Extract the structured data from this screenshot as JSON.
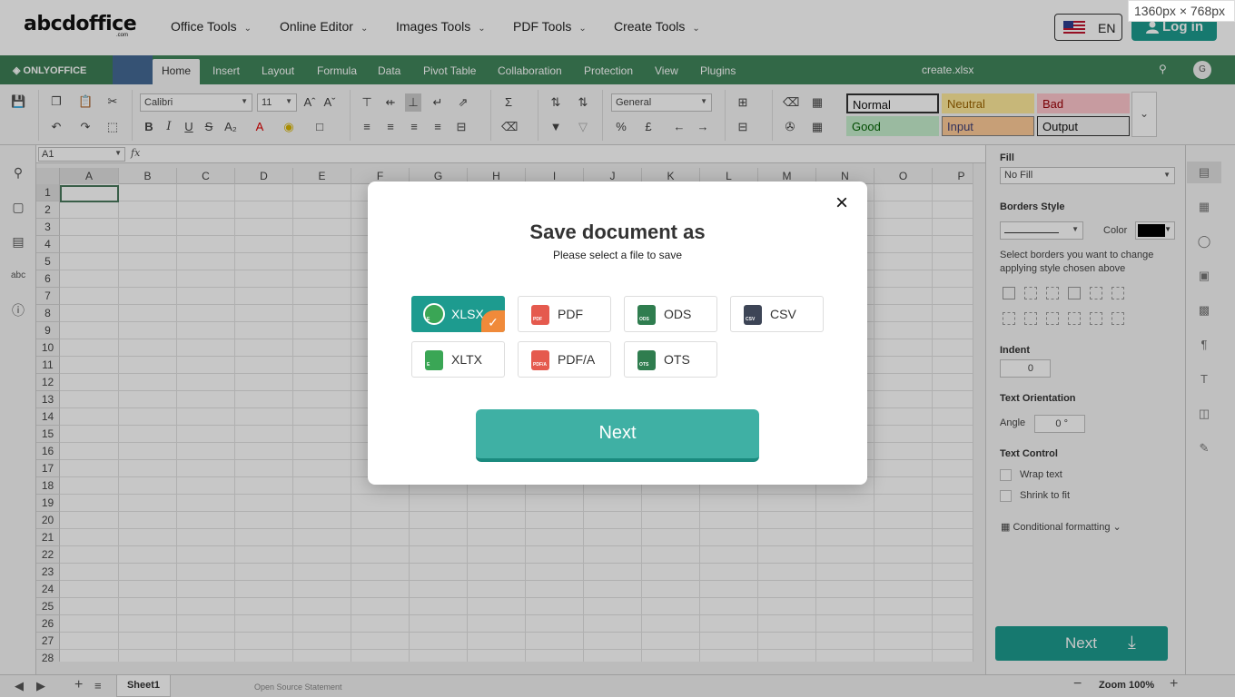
{
  "site": {
    "logo": "abcdoffice",
    "logo_sub": ".com",
    "nav": [
      "Office Tools",
      "Online Editor",
      "Images Tools",
      "PDF Tools",
      "Create Tools"
    ],
    "lang": "EN",
    "login": "Log in",
    "size_badge": "1360px × 768px"
  },
  "editor": {
    "brand": "ONLYOFFICE",
    "tabs": [
      "Home",
      "Insert",
      "Layout",
      "Formula",
      "Data",
      "Pivot Table",
      "Collaboration",
      "Protection",
      "View",
      "Plugins"
    ],
    "active_tab": "Home",
    "doc_title": "create.xlsx",
    "avatar_initial": "G"
  },
  "toolbar": {
    "font_name": "Calibri",
    "font_size": "11",
    "number_format": "General",
    "styles": [
      {
        "label": "Normal",
        "bg": "#ffffff",
        "fg": "#111111",
        "border": "#333333"
      },
      {
        "label": "Neutral",
        "bg": "#ffeb9c",
        "fg": "#9c6500",
        "border": "#ffeb9c"
      },
      {
        "label": "Bad",
        "bg": "#ffc7ce",
        "fg": "#9c0006",
        "border": "#ffc7ce"
      },
      {
        "label": "Good",
        "bg": "#c6efce",
        "fg": "#006100",
        "border": "#c6efce"
      },
      {
        "label": "Input",
        "bg": "#ffcc99",
        "fg": "#3f3f76",
        "border": "#7f7f7f"
      },
      {
        "label": "Output",
        "bg": "#f2f2f2",
        "fg": "#111111",
        "border": "#333333"
      }
    ]
  },
  "formula_bar": {
    "cell_ref": "A1",
    "fx": "fx"
  },
  "grid": {
    "columns": [
      "A",
      "B",
      "C",
      "D",
      "E",
      "F",
      "G",
      "H",
      "I",
      "J",
      "K",
      "L",
      "M",
      "N",
      "O",
      "P"
    ],
    "rows": [
      "1",
      "2",
      "3",
      "4",
      "5",
      "6",
      "7",
      "8",
      "9",
      "10",
      "11",
      "12",
      "13",
      "14",
      "15",
      "16",
      "17",
      "18",
      "19",
      "20",
      "21",
      "22",
      "23",
      "24",
      "25",
      "26",
      "27",
      "28"
    ]
  },
  "bottom": {
    "sheet": "Sheet1",
    "open_source": "Open Source Statement",
    "zoom": "Zoom 100%"
  },
  "right_panel": {
    "fill_label": "Fill",
    "fill_value": "No Fill",
    "borders_label": "Borders Style",
    "color_label": "Color",
    "borders_hint": "Select borders you want to change applying style chosen above",
    "indent_label": "Indent",
    "indent_value": "0",
    "orientation_label": "Text Orientation",
    "angle_label": "Angle",
    "angle_value": "0 °",
    "text_control_label": "Text Control",
    "wrap_text": "Wrap text",
    "shrink_to_fit": "Shrink to fit",
    "conditional_formatting": "Conditional formatting",
    "next": "Next"
  },
  "dialog": {
    "title": "Save document as",
    "subtitle": "Please select a file to save",
    "formats": [
      {
        "label": "XLSX",
        "icon": "xlsx-file-icon",
        "color": "#3aa655",
        "tag": "E",
        "selected": true
      },
      {
        "label": "PDF",
        "icon": "pdf-file-icon",
        "color": "#e55a4e",
        "tag": "PDF",
        "selected": false
      },
      {
        "label": "ODS",
        "icon": "ods-file-icon",
        "color": "#2f7d4f",
        "tag": "ODS",
        "selected": false
      },
      {
        "label": "CSV",
        "icon": "csv-file-icon",
        "color": "#3d4556",
        "tag": "CSV",
        "selected": false
      },
      {
        "label": "XLTX",
        "icon": "xltx-file-icon",
        "color": "#3aa655",
        "tag": "E",
        "selected": false
      },
      {
        "label": "PDF/A",
        "icon": "pdfa-file-icon",
        "color": "#e55a4e",
        "tag": "PDF/A",
        "selected": false
      },
      {
        "label": "OTS",
        "icon": "ots-file-icon",
        "color": "#2f7d4f",
        "tag": "OTS",
        "selected": false
      }
    ],
    "next": "Next",
    "close": "×"
  }
}
